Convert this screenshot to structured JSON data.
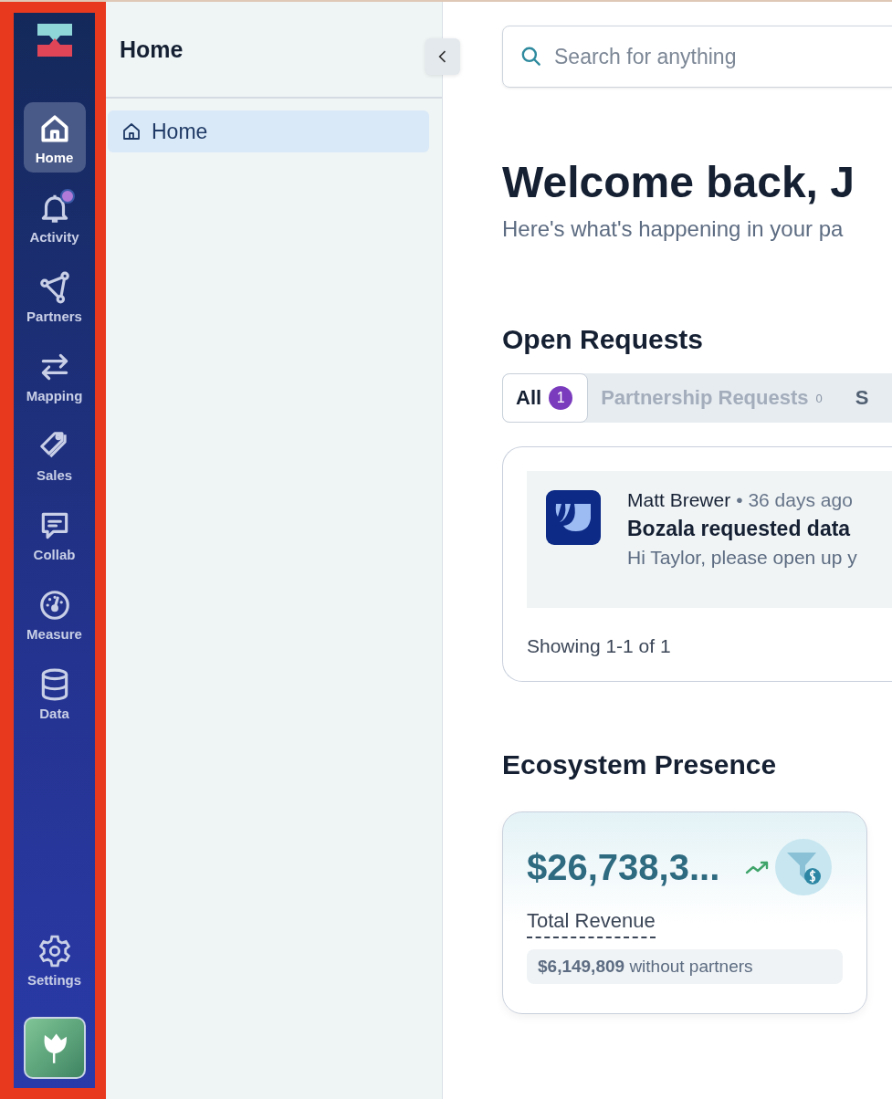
{
  "nav": {
    "items": [
      {
        "label": "Home",
        "selected": true,
        "notification": false
      },
      {
        "label": "Activity",
        "selected": false,
        "notification": true
      },
      {
        "label": "Partners",
        "selected": false,
        "notification": false
      },
      {
        "label": "Mapping",
        "selected": false,
        "notification": false
      },
      {
        "label": "Sales",
        "selected": false,
        "notification": false
      },
      {
        "label": "Collab",
        "selected": false,
        "notification": false
      },
      {
        "label": "Measure",
        "selected": false,
        "notification": false
      },
      {
        "label": "Data",
        "selected": false,
        "notification": false
      }
    ],
    "settings": {
      "label": "Settings"
    }
  },
  "sidebar": {
    "title": "Home",
    "items": [
      {
        "label": "Home",
        "selected": true
      }
    ]
  },
  "search": {
    "placeholder": "Search for anything"
  },
  "welcome": {
    "title": "Welcome back, J",
    "subtitle": "Here's what's happening in your pa"
  },
  "open_requests": {
    "title": "Open Requests",
    "tabs": [
      {
        "label": "All",
        "count": "1",
        "selected": true
      },
      {
        "label": "Partnership Requests",
        "count": "0",
        "selected": false
      },
      {
        "label": "S",
        "selected": false
      }
    ],
    "requests": [
      {
        "author": "Matt Brewer",
        "separator": "•",
        "time": "36 days ago",
        "title": "Bozala requested data",
        "message": "Hi Taylor, please open up y"
      }
    ],
    "footer": "Showing 1-1 of 1"
  },
  "ecosystem": {
    "title": "Ecosystem Presence",
    "cards": [
      {
        "value": "$26,738,3...",
        "label": "Total Revenue",
        "note_amount": "$6,149,809",
        "note": "without partners"
      }
    ]
  }
}
